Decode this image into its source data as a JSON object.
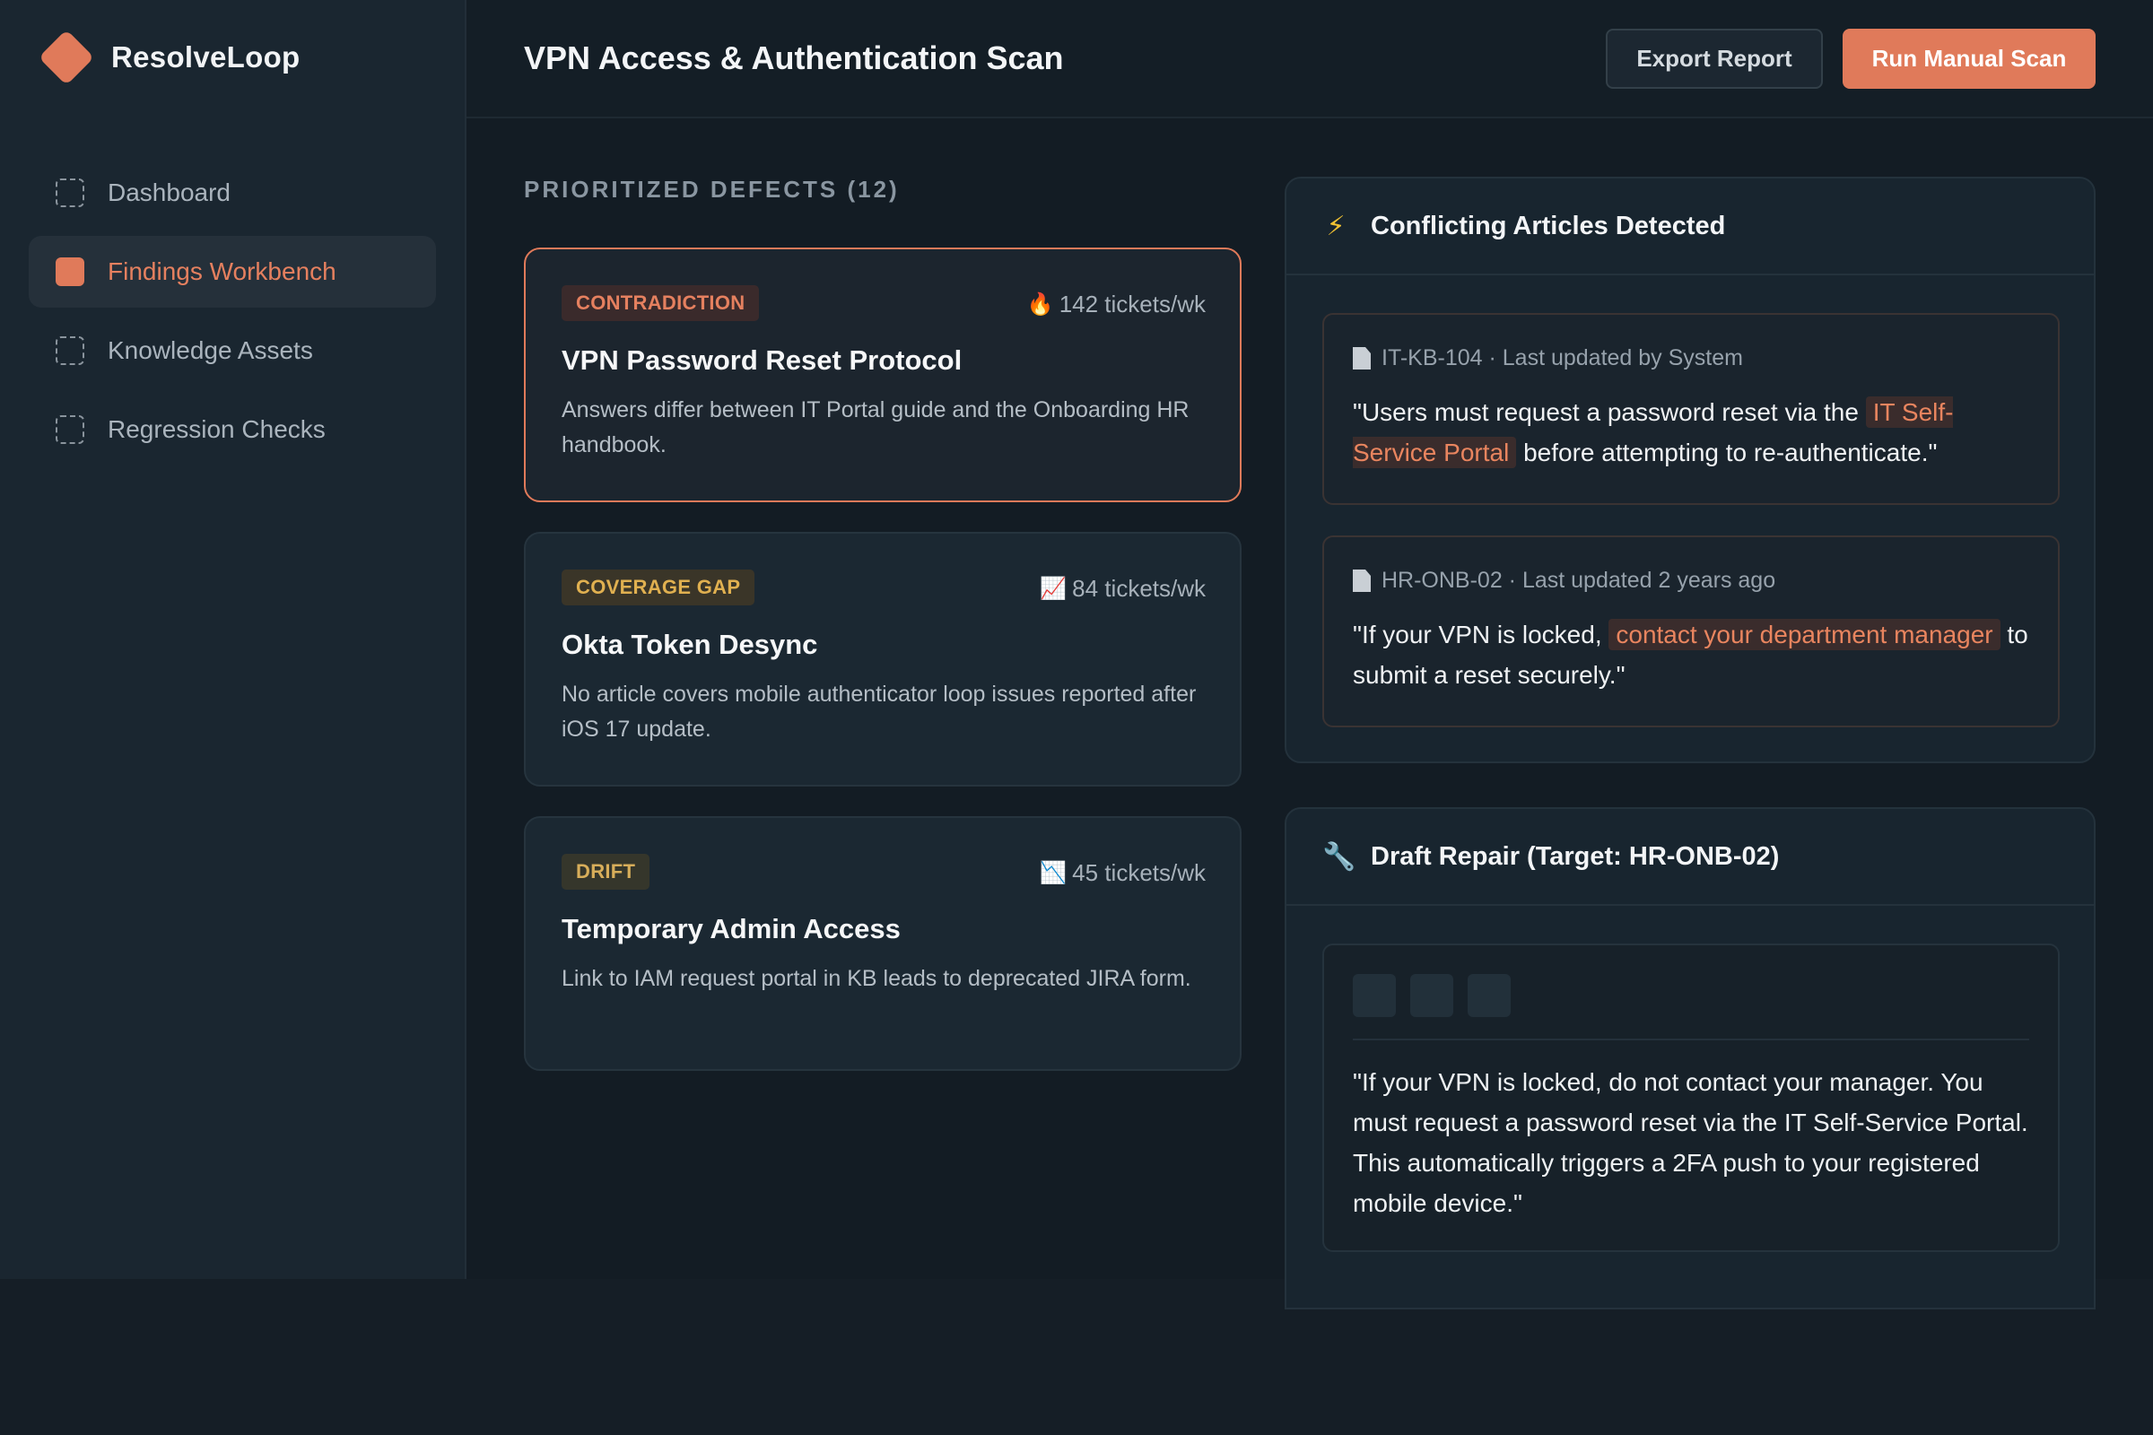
{
  "app": {
    "name": "ResolveLoop"
  },
  "sidebar": {
    "items": [
      {
        "label": "Dashboard"
      },
      {
        "label": "Findings Workbench"
      },
      {
        "label": "Knowledge Assets"
      },
      {
        "label": "Regression Checks"
      }
    ]
  },
  "header": {
    "title": "VPN Access & Authentication Scan",
    "export_label": "Export Report",
    "scan_label": "Run Manual Scan"
  },
  "defects": {
    "section_label": "PRIORITIZED DEFECTS (12)",
    "items": [
      {
        "badge": "CONTRADICTION",
        "icon": "fire-icon",
        "glyph": "🔥",
        "tickets": "142 tickets/wk",
        "title": "VPN Password Reset Protocol",
        "desc": "Answers differ between IT Portal guide and the Onboarding HR handbook."
      },
      {
        "badge": "COVERAGE GAP",
        "icon": "trend-up-icon",
        "glyph": "📈",
        "tickets": "84 tickets/wk",
        "title": "Okta Token Desync",
        "desc": "No article covers mobile authenticator loop issues reported after iOS 17 update."
      },
      {
        "badge": "DRIFT",
        "icon": "trend-down-icon",
        "glyph": "📉",
        "tickets": "45 tickets/wk",
        "title": "Temporary Admin Access",
        "desc": "Link to IAM request portal in KB leads to deprecated JIRA form."
      }
    ]
  },
  "conflicts": {
    "icon": "lightning-icon",
    "title": "Conflicting Articles Detected",
    "articles": [
      {
        "meta": "IT-KB-104 · Last updated by System",
        "pre": "\"Users must request a password reset via the ",
        "highlight": "IT Self-Service Portal",
        "post": " before attempting to re-authenticate.\""
      },
      {
        "meta": "HR-ONB-02 · Last updated 2 years ago",
        "pre": "\"If your VPN is locked, ",
        "highlight": "contact your department manager",
        "post": " to submit a reset securely.\""
      }
    ]
  },
  "repair": {
    "icon": "wrench-icon",
    "title": "Draft Repair (Target: HR-ONB-02)",
    "text": "\"If your VPN is locked, do not contact your manager. You must request a password reset via the IT Self-Service Portal. This automatically triggers a 2FA push to your registered mobile device.\""
  },
  "colors": {
    "accent": "#e07a5a",
    "background": "#131c24",
    "sidebar": "#1a2630",
    "warning": "#e0b050"
  }
}
